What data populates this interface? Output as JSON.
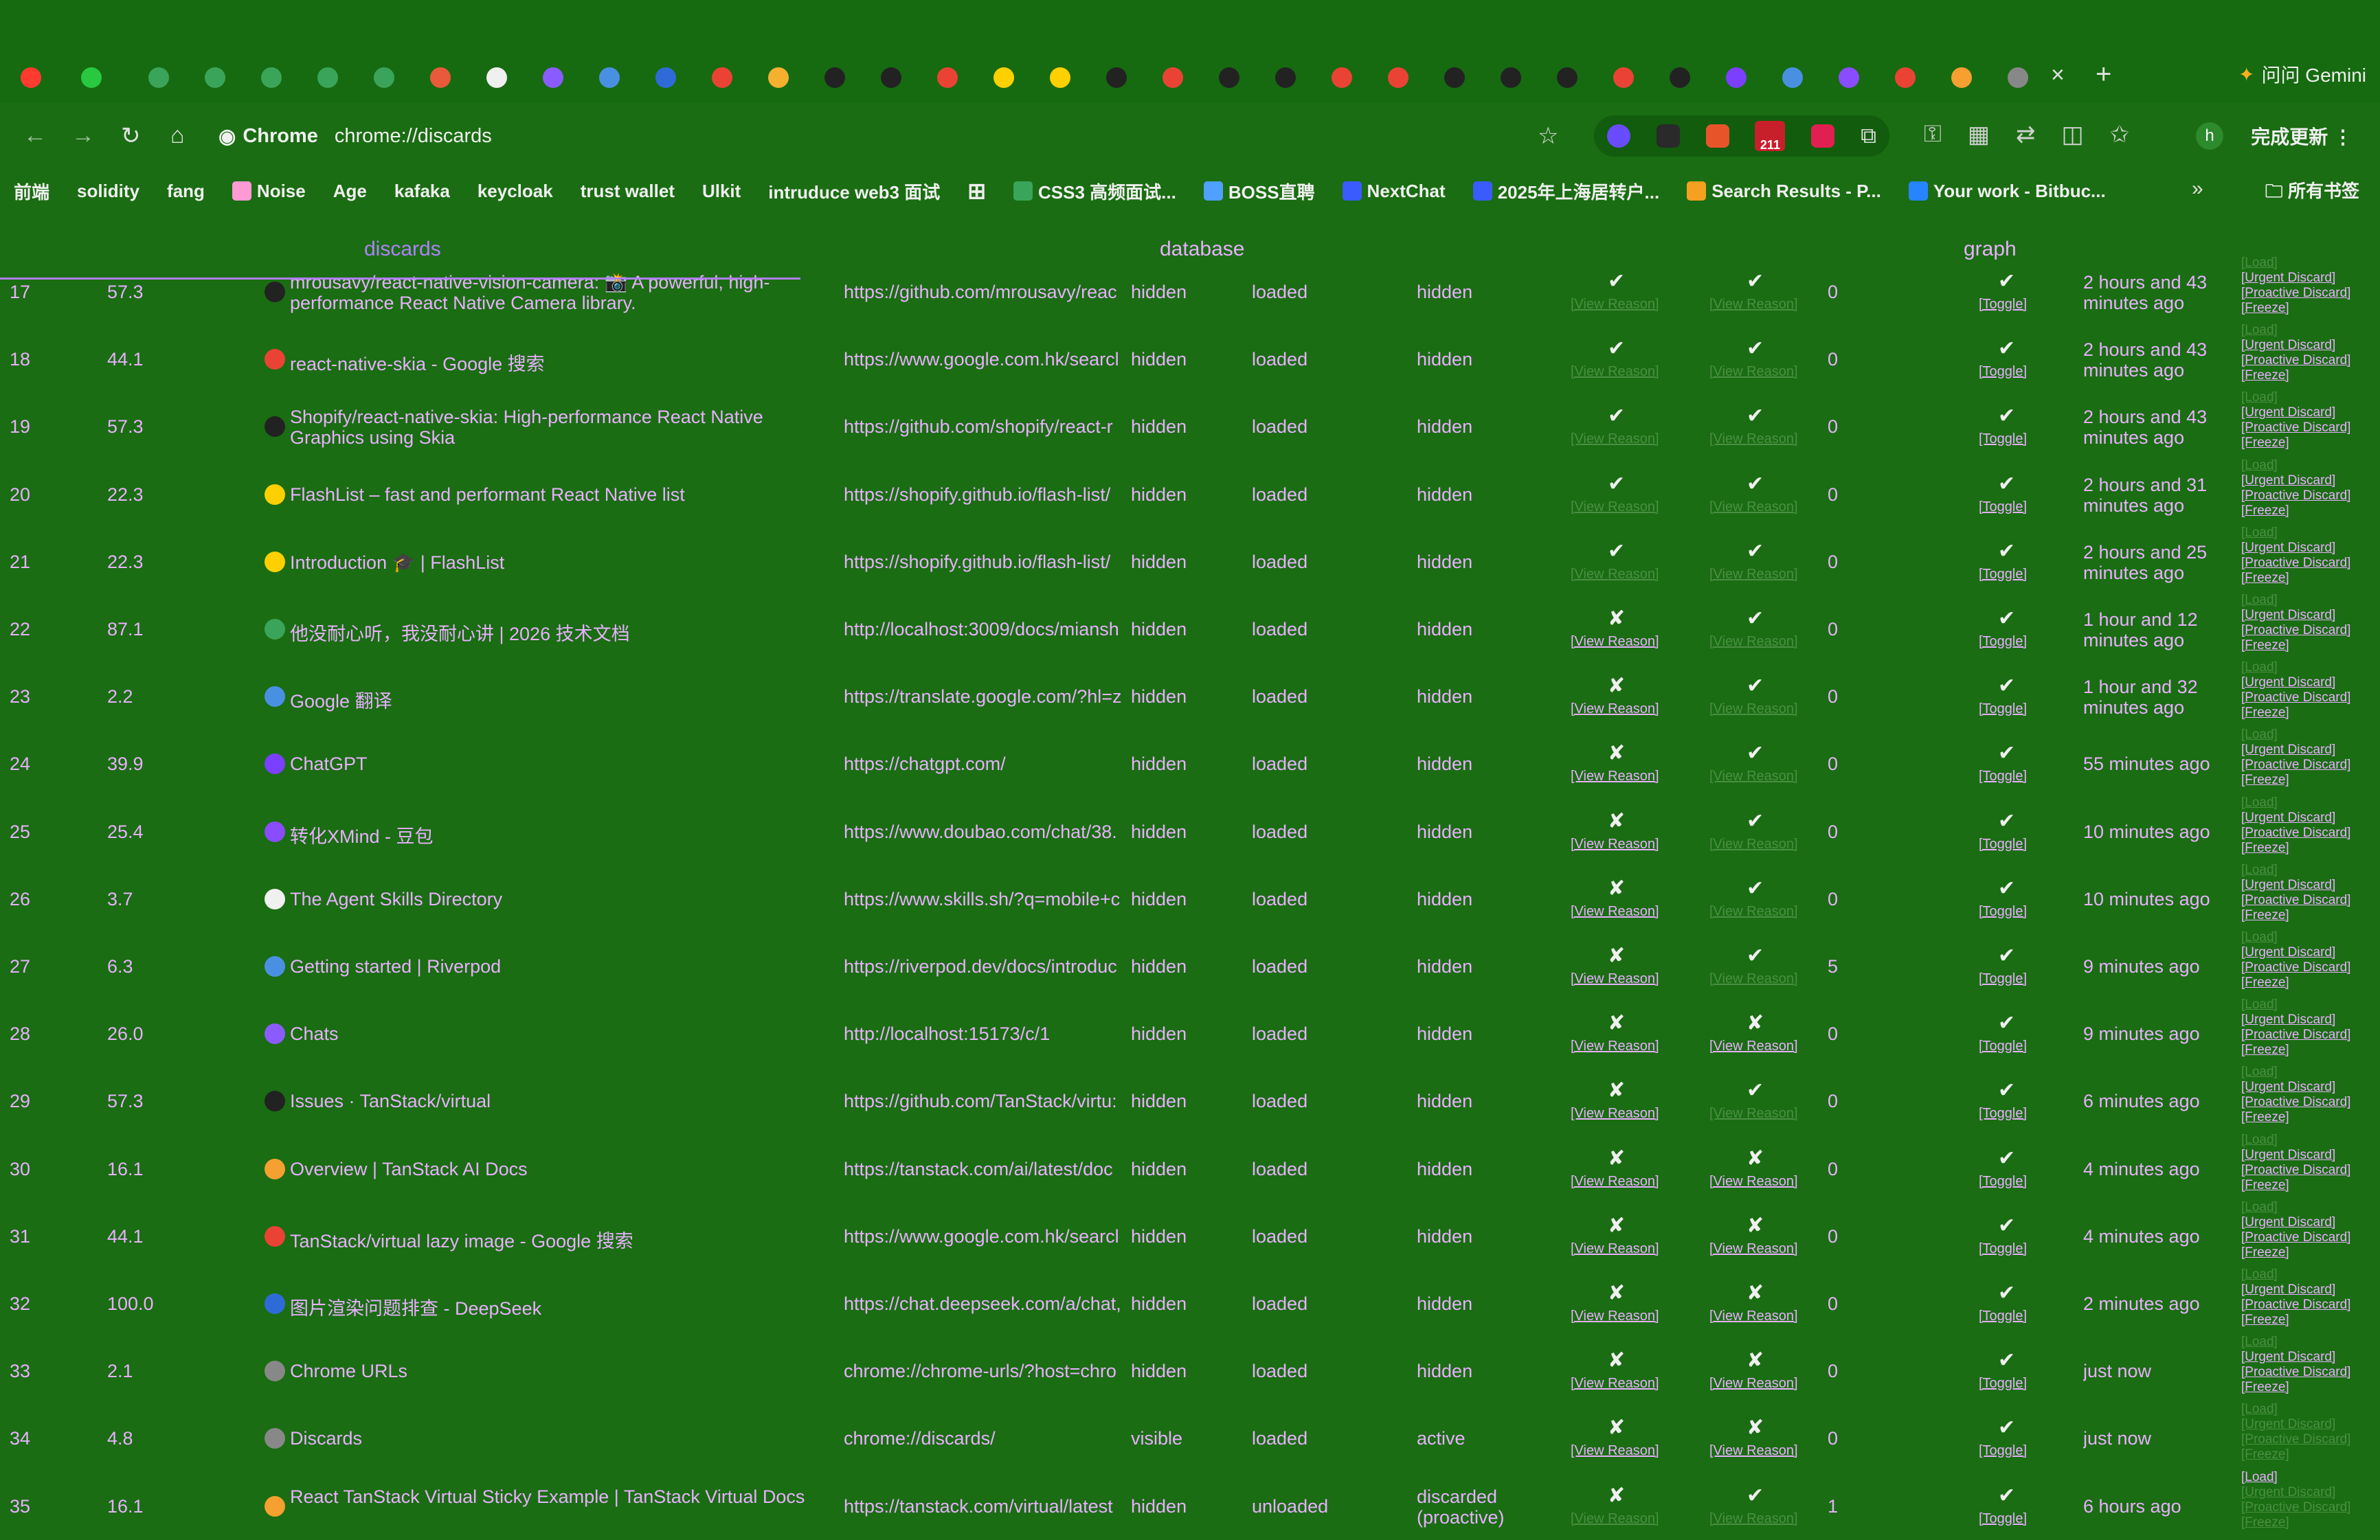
{
  "browser": {
    "new_tab": "+",
    "close_tab": "×",
    "gemini_label": "问问 Gemini",
    "chip_label": "Chrome",
    "url": "chrome://discards",
    "update_label": "完成更新",
    "avatar_letter": "h",
    "badge_count": "211",
    "tab_favicons": [
      "#3aa55a",
      "#3aa55a",
      "#3aa55a",
      "#3aa55a",
      "#3aa55a",
      "#e85a3a",
      "#f0f0f0",
      "#8a5cff",
      "#4a90e2",
      "#2f6bd8",
      "#ea4335",
      "#f5b030",
      "#222222",
      "#222222",
      "#ea4335",
      "#ffd000",
      "#ffd000",
      "#222222",
      "#ea4335",
      "#222222",
      "#222222",
      "#ea4335",
      "#ea4335",
      "#222222",
      "#222222",
      "#222222",
      "#ea4335",
      "#222222",
      "#7a3fff",
      "#4a90e2",
      "#8a4cff",
      "#ea4335",
      "#f5a030",
      "#888888"
    ]
  },
  "bookmarks": [
    {
      "label": "前端",
      "icon": ""
    },
    {
      "label": "solidity",
      "icon": ""
    },
    {
      "label": "fang",
      "icon": ""
    },
    {
      "label": "Noise",
      "icon": "#ff9ad5"
    },
    {
      "label": "Age",
      "icon": ""
    },
    {
      "label": "kafaka",
      "icon": ""
    },
    {
      "label": "keycloak",
      "icon": ""
    },
    {
      "label": "trust wallet",
      "icon": ""
    },
    {
      "label": "Ulkit",
      "icon": ""
    },
    {
      "label": "intruduce web3 面试",
      "icon": ""
    },
    {
      "label": "",
      "icon": "grid"
    },
    {
      "label": "CSS3 高频面试...",
      "icon": "#3aa55a"
    },
    {
      "label": "BOSS直聘",
      "icon": "#4fa0ff"
    },
    {
      "label": "NextChat",
      "icon": "#3a5cff"
    },
    {
      "label": "2025年上海居转户...",
      "icon": "#3a5cff"
    },
    {
      "label": "Search Results - P...",
      "icon": "#f5a020"
    },
    {
      "label": "Your work - Bitbuc...",
      "icon": "#2684ff"
    }
  ],
  "all_bookmarks_label": "所有书签",
  "page_tabs": [
    "discards",
    "database",
    "graph"
  ],
  "rows": [
    {
      "id": "17",
      "score": "57.3",
      "title": "mrousavy/react-native-vision-camera: 📸 A powerful, high-performance React Native Camera library.",
      "url": "https://github.com/mrousavy/reac",
      "visibility": "hidden",
      "loading": "loaded",
      "lifecycle": "hidden",
      "can_discard": "✔",
      "can_discard_active": false,
      "can_freeze": "✔",
      "can_freeze_active": false,
      "discard_count": "0",
      "toggle": "✔",
      "last_active": "2 hours and 43 minutes ago",
      "load_active": false,
      "icon": "#222222"
    },
    {
      "id": "18",
      "score": "44.1",
      "title": "react-native-skia - Google 搜索",
      "url": "https://www.google.com.hk/searcl",
      "visibility": "hidden",
      "loading": "loaded",
      "lifecycle": "hidden",
      "can_discard": "✔",
      "can_discard_active": false,
      "can_freeze": "✔",
      "can_freeze_active": false,
      "discard_count": "0",
      "toggle": "✔",
      "last_active": "2 hours and 43 minutes ago",
      "load_active": false,
      "icon": "#ea4335"
    },
    {
      "id": "19",
      "score": "57.3",
      "title": "Shopify/react-native-skia: High-performance React Native Graphics using Skia",
      "url": "https://github.com/shopify/react-r",
      "visibility": "hidden",
      "loading": "loaded",
      "lifecycle": "hidden",
      "can_discard": "✔",
      "can_discard_active": false,
      "can_freeze": "✔",
      "can_freeze_active": false,
      "discard_count": "0",
      "toggle": "✔",
      "last_active": "2 hours and 43 minutes ago",
      "load_active": false,
      "icon": "#222222"
    },
    {
      "id": "20",
      "score": "22.3",
      "title": "FlashList – fast and performant React Native list",
      "url": "https://shopify.github.io/flash-list/",
      "visibility": "hidden",
      "loading": "loaded",
      "lifecycle": "hidden",
      "can_discard": "✔",
      "can_discard_active": false,
      "can_freeze": "✔",
      "can_freeze_active": false,
      "discard_count": "0",
      "toggle": "✔",
      "last_active": "2 hours and 31 minutes ago",
      "load_active": false,
      "icon": "#ffd000"
    },
    {
      "id": "21",
      "score": "22.3",
      "title": "Introduction 🎓 | FlashList",
      "url": "https://shopify.github.io/flash-list/",
      "visibility": "hidden",
      "loading": "loaded",
      "lifecycle": "hidden",
      "can_discard": "✔",
      "can_discard_active": false,
      "can_freeze": "✔",
      "can_freeze_active": false,
      "discard_count": "0",
      "toggle": "✔",
      "last_active": "2 hours and 25 minutes ago",
      "load_active": false,
      "icon": "#ffd000"
    },
    {
      "id": "22",
      "score": "87.1",
      "title": "他没耐心听，我没耐心讲 | 2026 技术文档",
      "url": "http://localhost:3009/docs/miansh",
      "visibility": "hidden",
      "loading": "loaded",
      "lifecycle": "hidden",
      "can_discard": "✘",
      "can_discard_active": true,
      "can_freeze": "✔",
      "can_freeze_active": false,
      "discard_count": "0",
      "toggle": "✔",
      "last_active": "1 hour and 12 minutes ago",
      "load_active": false,
      "icon": "#3aa55a"
    },
    {
      "id": "23",
      "score": "2.2",
      "title": "Google 翻译",
      "url": "https://translate.google.com/?hl=z",
      "visibility": "hidden",
      "loading": "loaded",
      "lifecycle": "hidden",
      "can_discard": "✘",
      "can_discard_active": true,
      "can_freeze": "✔",
      "can_freeze_active": false,
      "discard_count": "0",
      "toggle": "✔",
      "last_active": "1 hour and 32 minutes ago",
      "load_active": false,
      "icon": "#4a90e2"
    },
    {
      "id": "24",
      "score": "39.9",
      "title": "ChatGPT",
      "url": "https://chatgpt.com/",
      "visibility": "hidden",
      "loading": "loaded",
      "lifecycle": "hidden",
      "can_discard": "✘",
      "can_discard_active": true,
      "can_freeze": "✔",
      "can_freeze_active": false,
      "discard_count": "0",
      "toggle": "✔",
      "last_active": "55 minutes ago",
      "load_active": false,
      "icon": "#7a3fff"
    },
    {
      "id": "25",
      "score": "25.4",
      "title": "转化XMind - 豆包",
      "url": "https://www.doubao.com/chat/38.",
      "visibility": "hidden",
      "loading": "loaded",
      "lifecycle": "hidden",
      "can_discard": "✘",
      "can_discard_active": true,
      "can_freeze": "✔",
      "can_freeze_active": false,
      "discard_count": "0",
      "toggle": "✔",
      "last_active": "10 minutes ago",
      "load_active": false,
      "icon": "#8a4cff"
    },
    {
      "id": "26",
      "score": "3.7",
      "title": "The Agent Skills Directory",
      "url": "https://www.skills.sh/?q=mobile+c",
      "visibility": "hidden",
      "loading": "loaded",
      "lifecycle": "hidden",
      "can_discard": "✘",
      "can_discard_active": true,
      "can_freeze": "✔",
      "can_freeze_active": false,
      "discard_count": "0",
      "toggle": "✔",
      "last_active": "10 minutes ago",
      "load_active": false,
      "icon": "#f0f0f0"
    },
    {
      "id": "27",
      "score": "6.3",
      "title": "Getting started | Riverpod",
      "url": "https://riverpod.dev/docs/introduc",
      "visibility": "hidden",
      "loading": "loaded",
      "lifecycle": "hidden",
      "can_discard": "✘",
      "can_discard_active": true,
      "can_freeze": "✔",
      "can_freeze_active": false,
      "discard_count": "5",
      "toggle": "✔",
      "last_active": "9 minutes ago",
      "load_active": false,
      "icon": "#4a90e2"
    },
    {
      "id": "28",
      "score": "26.0",
      "title": "Chats",
      "url": "http://localhost:15173/c/1",
      "visibility": "hidden",
      "loading": "loaded",
      "lifecycle": "hidden",
      "can_discard": "✘",
      "can_discard_active": true,
      "can_freeze": "✘",
      "can_freeze_active": true,
      "discard_count": "0",
      "toggle": "✔",
      "last_active": "9 minutes ago",
      "load_active": false,
      "icon": "#8a5cff"
    },
    {
      "id": "29",
      "score": "57.3",
      "title": "Issues · TanStack/virtual",
      "url": "https://github.com/TanStack/virtu:",
      "visibility": "hidden",
      "loading": "loaded",
      "lifecycle": "hidden",
      "can_discard": "✘",
      "can_discard_active": true,
      "can_freeze": "✔",
      "can_freeze_active": false,
      "discard_count": "0",
      "toggle": "✔",
      "last_active": "6 minutes ago",
      "load_active": false,
      "icon": "#222222"
    },
    {
      "id": "30",
      "score": "16.1",
      "title": "Overview | TanStack AI Docs",
      "url": "https://tanstack.com/ai/latest/doc",
      "visibility": "hidden",
      "loading": "loaded",
      "lifecycle": "hidden",
      "can_discard": "✘",
      "can_discard_active": true,
      "can_freeze": "✘",
      "can_freeze_active": true,
      "discard_count": "0",
      "toggle": "✔",
      "last_active": "4 minutes ago",
      "load_active": false,
      "icon": "#f5a030"
    },
    {
      "id": "31",
      "score": "44.1",
      "title": "TanStack/virtual lazy image - Google 搜索",
      "url": "https://www.google.com.hk/searcl",
      "visibility": "hidden",
      "loading": "loaded",
      "lifecycle": "hidden",
      "can_discard": "✘",
      "can_discard_active": true,
      "can_freeze": "✘",
      "can_freeze_active": true,
      "discard_count": "0",
      "toggle": "✔",
      "last_active": "4 minutes ago",
      "load_active": false,
      "icon": "#ea4335"
    },
    {
      "id": "32",
      "score": "100.0",
      "title": "图片渲染问题排查 - DeepSeek",
      "url": "https://chat.deepseek.com/a/chat,",
      "visibility": "hidden",
      "loading": "loaded",
      "lifecycle": "hidden",
      "can_discard": "✘",
      "can_discard_active": true,
      "can_freeze": "✘",
      "can_freeze_active": true,
      "discard_count": "0",
      "toggle": "✔",
      "last_active": "2 minutes ago",
      "load_active": false,
      "icon": "#2f6bd8"
    },
    {
      "id": "33",
      "score": "2.1",
      "title": "Chrome URLs",
      "url": "chrome://chrome-urls/?host=chro",
      "visibility": "hidden",
      "loading": "loaded",
      "lifecycle": "hidden",
      "can_discard": "✘",
      "can_discard_active": true,
      "can_freeze": "✘",
      "can_freeze_active": true,
      "discard_count": "0",
      "toggle": "✔",
      "last_active": "just now",
      "load_active": false,
      "icon": "#888888"
    },
    {
      "id": "34",
      "score": "4.8",
      "title": "Discards",
      "url": "chrome://discards/",
      "visibility": "visible",
      "loading": "loaded",
      "lifecycle": "active",
      "can_discard": "✘",
      "can_discard_active": true,
      "can_freeze": "✘",
      "can_freeze_active": true,
      "discard_count": "0",
      "toggle": "✔",
      "last_active": "just now",
      "load_active": false,
      "icon": "#888888"
    },
    {
      "id": "35",
      "score": "16.1",
      "title": "React TanStack Virtual Sticky Example | TanStack Virtual Docs",
      "url": "https://tanstack.com/virtual/latest",
      "visibility": "hidden",
      "loading": "unloaded",
      "lifecycle": "discarded (proactive)",
      "can_discard": "✘",
      "can_discard_active": false,
      "can_freeze": "✔",
      "can_freeze_active": false,
      "discard_count": "1",
      "toggle": "✔",
      "last_active": "6 hours ago",
      "load_active": true,
      "icon": "#f5a030"
    }
  ],
  "labels": {
    "view_reason": "[View Reason]",
    "toggle": "[Toggle]",
    "load": "[Load]",
    "urgent_discard": "[Urgent Discard]",
    "proactive_discard": "[Proactive Discard]",
    "freeze": "[Freeze]"
  },
  "colors": {
    "background": "#1a6d12",
    "text": "#e8b0ff",
    "dim": "#4a8f44"
  }
}
